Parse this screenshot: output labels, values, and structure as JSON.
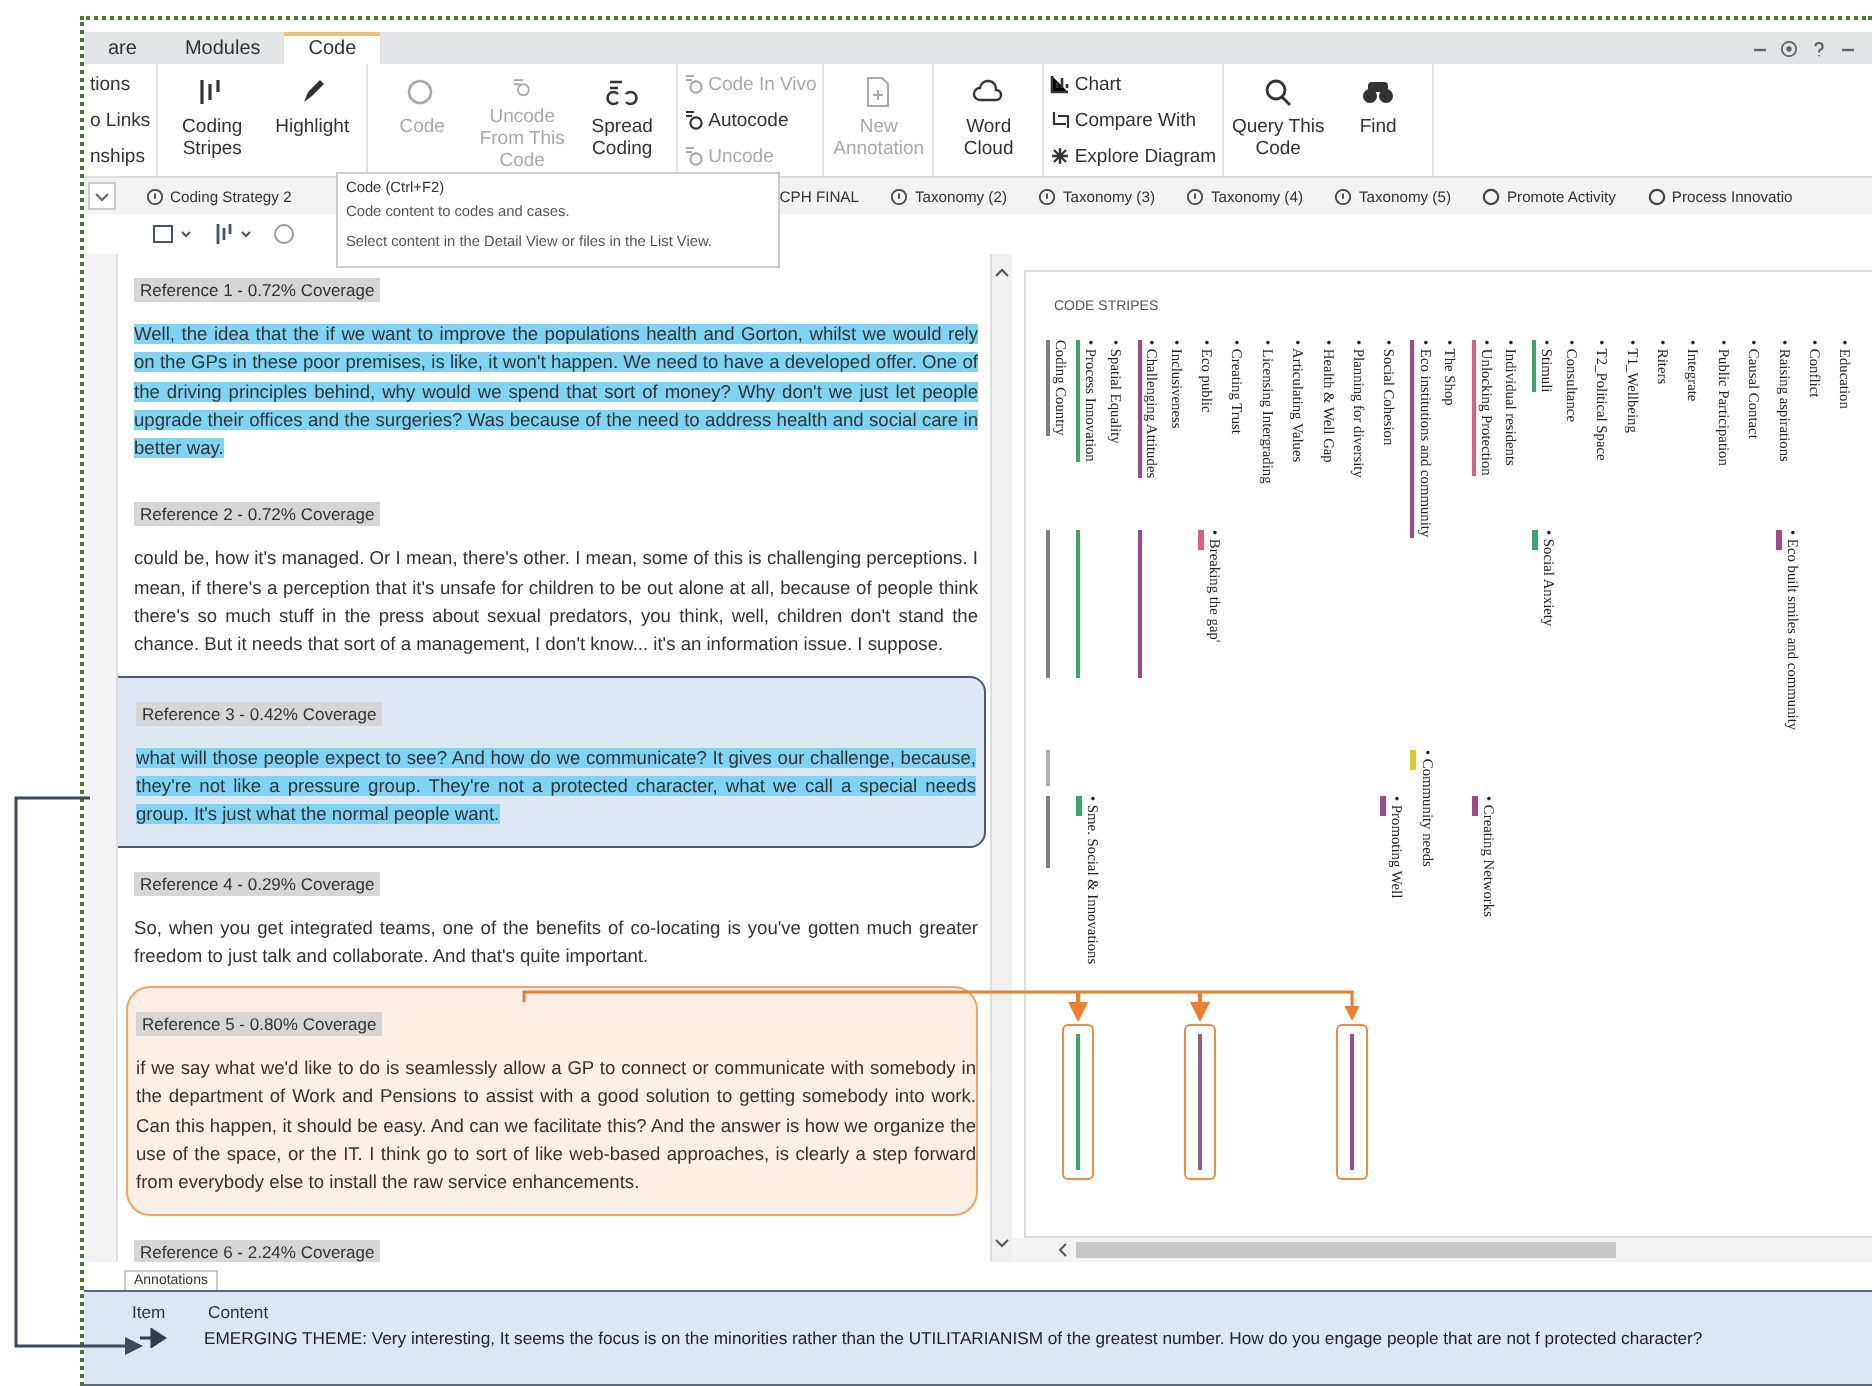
{
  "ribbon": {
    "tabs": [
      {
        "label": "are",
        "selected": false
      },
      {
        "label": "Modules",
        "selected": false
      },
      {
        "label": "Code",
        "selected": true
      }
    ],
    "groups": [
      {
        "kind": "small",
        "items": [
          {
            "label": "tions",
            "disabled": false
          },
          {
            "label": "o Links",
            "disabled": false
          },
          {
            "label": "nships",
            "disabled": false
          }
        ]
      },
      {
        "kind": "large",
        "items": [
          {
            "label": "Coding Stripes",
            "disabled": false
          },
          {
            "label": "Highlight",
            "disabled": false
          }
        ]
      },
      {
        "kind": "large",
        "items": [
          {
            "label": "Code",
            "disabled": true
          },
          {
            "label": "Uncode From This Code",
            "disabled": true
          },
          {
            "label": "Spread Coding",
            "disabled": false
          }
        ]
      },
      {
        "kind": "small",
        "items": [
          {
            "label": "Code In Vivo",
            "disabled": true
          },
          {
            "label": "Autocode",
            "disabled": false
          },
          {
            "label": "Uncode",
            "disabled": true
          }
        ]
      },
      {
        "kind": "large",
        "items": [
          {
            "label": "New Annotation",
            "disabled": true
          }
        ]
      },
      {
        "kind": "large",
        "items": [
          {
            "label": "Word Cloud",
            "disabled": false
          }
        ]
      },
      {
        "kind": "small",
        "items": [
          {
            "label": "Chart",
            "disabled": false
          },
          {
            "label": "Compare With",
            "disabled": false
          },
          {
            "label": "Explore Diagram",
            "disabled": false
          }
        ]
      },
      {
        "kind": "large",
        "items": [
          {
            "label": "Query This Code",
            "disabled": false
          },
          {
            "label": "Find",
            "disabled": false
          }
        ]
      }
    ]
  },
  "doc_tabs": [
    "Coding Strategy 2",
    "CPH FINAL",
    "Taxonomy (2)",
    "Taxonomy (3)",
    "Taxonomy (4)",
    "Taxonomy (5)",
    "Promote Activity",
    "Process Innovatio"
  ],
  "tooltip": {
    "title": "Code  (Ctrl+F2)",
    "lines": [
      "Code content to codes and cases.",
      "Select content in the Detail View or files in the List View."
    ]
  },
  "references": [
    {
      "heading": "Reference 1 - 0.72% Coverage",
      "text": "Well, the idea that the if we want to improve the populations health and Gorton, whilst we would rely on the GPs in these poor premises, is like, it won't happen. We need to have a developed offer. One of the driving principles behind, why would we spend that sort of money? Why don't we just let people upgrade their offices and the surgeries? Was because of the need to address health and social care in better way.",
      "highlighted": true,
      "kind": "plain"
    },
    {
      "heading": "Reference 2 - 0.72% Coverage",
      "text": "could be, how it's managed. Or I mean, there's other. I mean, some of this is challenging perceptions. I mean, if there's a perception that it's unsafe for children to be out alone at all, because of people think there's so much stuff in the press about sexual predators, you think, well, children don't stand the chance. But it needs that sort of a management, I don't know...  it's an information issue. I suppose.",
      "highlighted": false,
      "kind": "plain"
    },
    {
      "heading": "Reference 3 - 0.42% Coverage",
      "text": "what will those people expect to see? And how do we communicate? It gives our challenge, because, they're not like a pressure group. They're not a protected character, what we call a special needs group. It's just what the normal people want.",
      "highlighted": true,
      "kind": "slate_callout"
    },
    {
      "heading": "Reference 4 - 0.29% Coverage",
      "text": "So, when you get integrated teams, one of the benefits of co-locating is you've gotten much greater freedom to just talk and collaborate. And that's quite important.",
      "highlighted": false,
      "kind": "plain"
    },
    {
      "heading": "Reference 5 - 0.80% Coverage",
      "text": "if we say what we'd like to do is seamlessly allow a GP to connect or communicate with somebody in the department of Work and Pensions to assist with a good solution to getting somebody into work. Can this happen, it should be easy. And can we facilitate this? And the answer is how we organize the use of the space, or the IT. I think go to sort of like web-based approaches, is clearly a step forward from everybody else to install the raw service enhancements.",
      "highlighted": false,
      "kind": "orange_callout"
    },
    {
      "heading": "Reference 6 - 2.24% Coverage",
      "kind": "plain"
    }
  ],
  "code_stripes": {
    "title": "CODE STRIPES",
    "columns": [
      {
        "label": "Coding Country",
        "color": "#808080"
      },
      {
        "label": "• Process Innovation",
        "color": "#3aa66b"
      },
      {
        "label": "• Spatial Equality"
      },
      {
        "label": "• Challenging Attitudes",
        "color": "#a04a8c"
      },
      {
        "label": "• Inclusiveness"
      },
      {
        "label": "• Eco public"
      },
      {
        "label": "• Creating Trust"
      },
      {
        "label": "• Licensing Intergrading"
      },
      {
        "label": "• Articulating Values"
      },
      {
        "label": "• Health & Well Gap"
      },
      {
        "label": "• Planning for diversity"
      },
      {
        "label": "• Social Cohesion"
      },
      {
        "label": "• Eco institutions and community",
        "color": "#a04a8c"
      },
      {
        "label": "• The Shop"
      },
      {
        "label": "• Unlocking Protection",
        "color": "#d9607e"
      },
      {
        "label": "• Individual residents"
      },
      {
        "label": "• Stimuli",
        "color": "#3aa66b"
      },
      {
        "label": "• Consultance"
      },
      {
        "label": "• T2_Political Space"
      },
      {
        "label": "• T1_Wellbeing"
      },
      {
        "label": "• Riters"
      },
      {
        "label": "• Integrate"
      },
      {
        "label": "• Public Participation"
      },
      {
        "label": "• Causal Contact"
      },
      {
        "label": "• Raising aspirations"
      },
      {
        "label": "• Conflict"
      },
      {
        "label": "• Education"
      }
    ],
    "rows": [
      {
        "items": [
          {
            "kind": "bar",
            "color": "#808080"
          },
          {
            "kind": "bar",
            "color": "#3aa66b"
          },
          {
            "kind": "bar",
            "color": "#a04a8c"
          },
          {
            "kind": "label",
            "color": "#d9607e",
            "text": "• Breaking the gap'"
          },
          {
            "kind": "label",
            "color": "#3aa66b",
            "text": "• Social Anxiety"
          },
          {
            "kind": "label",
            "color": "#a04a8c",
            "text": "• Eco built smiles and community"
          }
        ]
      },
      {
        "items": [
          {
            "kind": "bar",
            "color": "#b0b0b0"
          },
          {
            "kind": "label",
            "color": "#e8c62e",
            "text": "• Community needs"
          }
        ]
      },
      {
        "items": [
          {
            "kind": "bar",
            "color": "#808080"
          },
          {
            "kind": "label",
            "color": "#3aa66b",
            "text": "• Sme. Social & Innovations"
          },
          {
            "kind": "label",
            "color": "#a04a8c",
            "text": "• Promoting Well"
          },
          {
            "kind": "label",
            "color": "#a04a8c",
            "text": "• Creating Networks"
          }
        ]
      },
      {
        "items": [
          {
            "kind": "boxed_bar",
            "color": "#3aa66b"
          },
          {
            "kind": "boxed_bar",
            "color": "#9c5a78"
          },
          {
            "kind": "boxed_bar",
            "color": "#a04a8c"
          }
        ]
      }
    ]
  },
  "annotations": {
    "tab": "Annotations",
    "columns": [
      "Item",
      "Content"
    ],
    "rows": [
      {
        "content": "EMERGING THEME: Very interesting, It seems the focus is on the minorities rather than the UTILITARIANISM of the greatest number. How do you engage people that are not f protected character?"
      }
    ]
  }
}
